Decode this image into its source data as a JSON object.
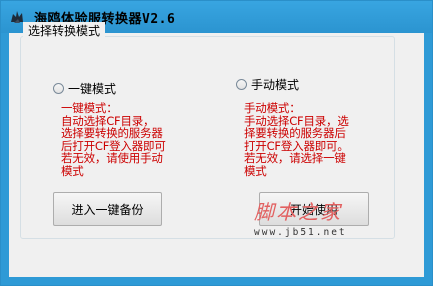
{
  "window": {
    "title": "海鸥体验服转换器V2.6",
    "icon": "app-logo-icon"
  },
  "group": {
    "label": "选择转换模式"
  },
  "modes": {
    "one_click": {
      "label": "一键模式",
      "selected": false,
      "description": "一键模式：\n自动选择CF目录，\n选择要转换的服务器\n后打开CF登入器即可\n若无效，请使用手动\n模式"
    },
    "manual": {
      "label": "手动模式",
      "selected": false,
      "description": "手动模式：\n手动选择CF目录，选\n择要转换的服务器后\n打开CF登入器即可。\n若无效，请选择一键\n模式"
    }
  },
  "buttons": {
    "backup_label": "进入一键备份",
    "start_label": "开始使用"
  },
  "watermark": {
    "brand": "脚本之家",
    "url": "www.jb51.net"
  },
  "colors": {
    "titlebar": "#2e9ad6",
    "description_text": "#cc0000",
    "watermark": "#e26060"
  }
}
